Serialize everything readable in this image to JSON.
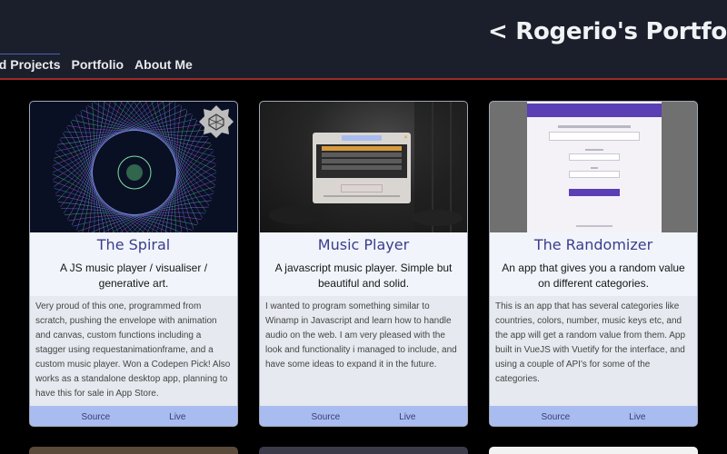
{
  "header": {
    "title": "< Rogerio's Portfolio / C",
    "nav": [
      "ed Projects",
      "Portfolio",
      "About Me"
    ]
  },
  "cards": [
    {
      "title": "The Spiral",
      "subtitle": "A JS music player / visualiser / generative art.",
      "description": "Very proud of this one, programmed from scratch, pushing the envelope with animation and canvas, custom functions including a stagger using requestanimationframe, and a custom music player. Won a Codepen Pick! Also works as a standalone desktop app, planning to have this for sale in App Store.",
      "source_label": "Source",
      "live_label": "Live"
    },
    {
      "title": "Music Player",
      "subtitle": "A javascript music player. Simple but beautiful and solid.",
      "description": "I wanted to program something similar to Winamp in Javascript and learn how to handle audio on the web. I am very pleased with the look and functionality i managed to include, and have some ideas to expand it in the future.",
      "source_label": "Source",
      "live_label": "Live"
    },
    {
      "title": "The Randomizer",
      "subtitle": "An app that gives you a random value on different categories.",
      "description": "This is an app that has several categories like countries, colors, number, music keys etc, and the app will get a random value from them. App built in VueJS with Vuetify for the interface, and using a couple of API's for some of the categories.",
      "source_label": "Source",
      "live_label": "Live"
    }
  ],
  "colors": {
    "header_bg": "#1b1f2c",
    "header_border": "#9c2a2a",
    "card_title": "#3c3c8c",
    "footer_bg": "#a9bcef"
  }
}
